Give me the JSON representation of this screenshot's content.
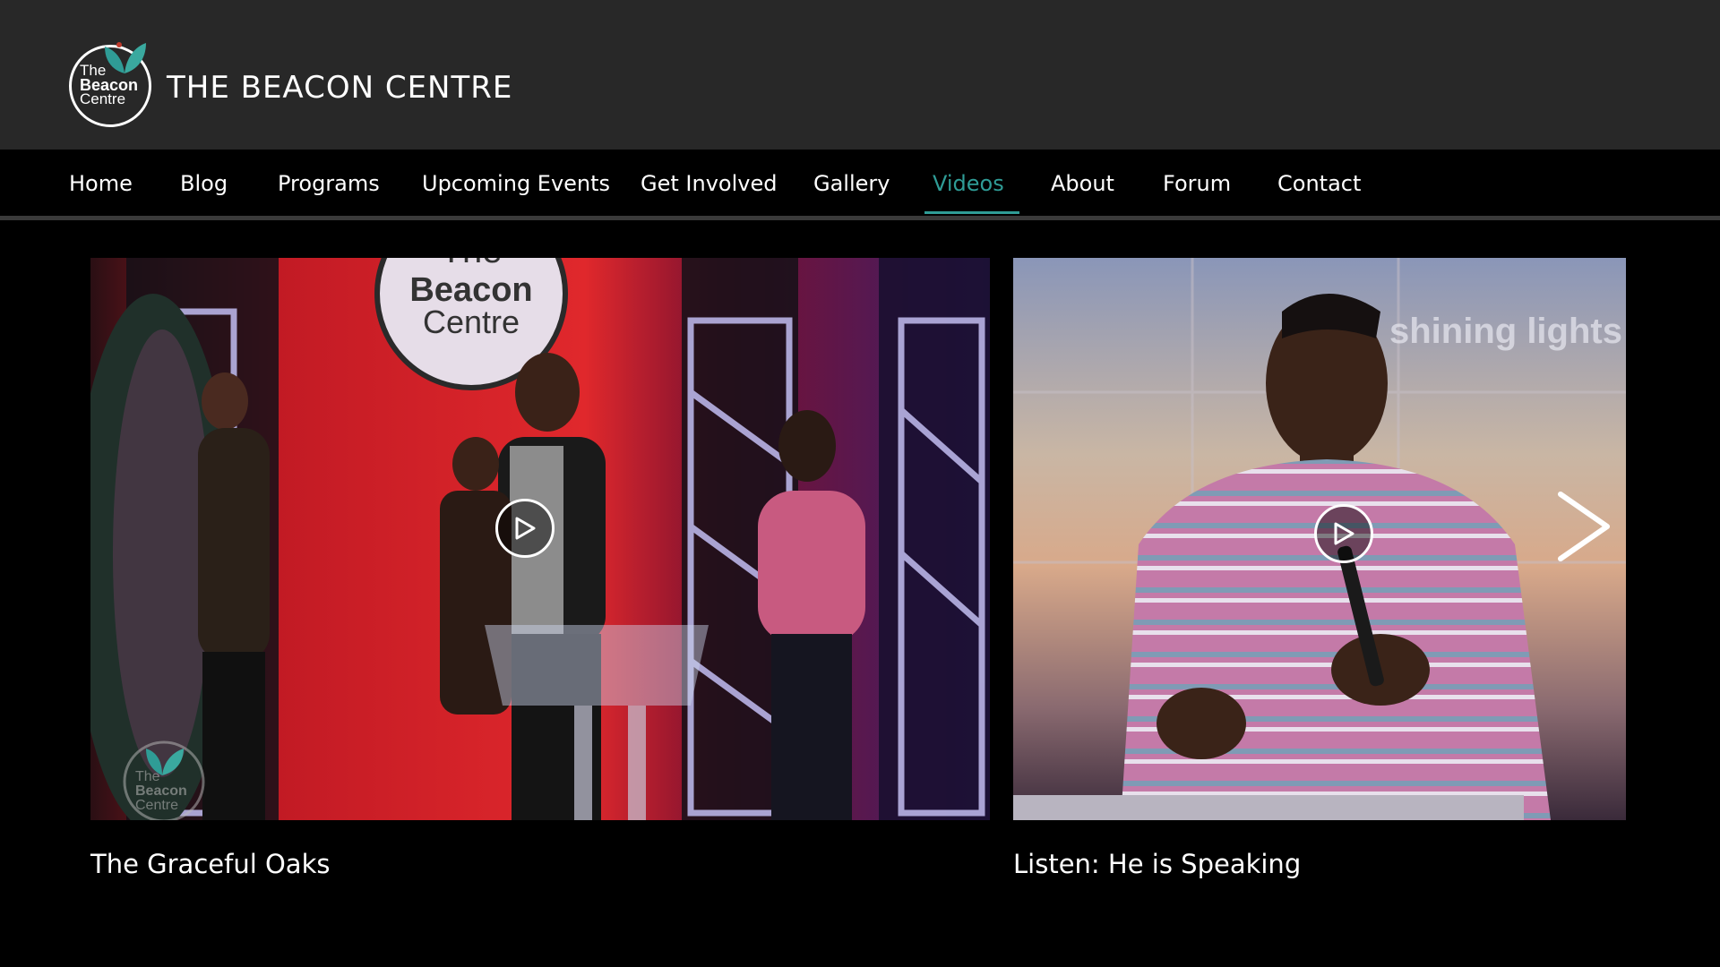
{
  "header": {
    "logo_line1": "The",
    "logo_line2": "Beacon",
    "logo_line3": "Centre",
    "site_title": "THE BEACON CENTRE"
  },
  "nav": {
    "items": [
      {
        "label": "Home"
      },
      {
        "label": "Blog"
      },
      {
        "label": "Programs"
      },
      {
        "label": "Upcoming Events"
      },
      {
        "label": "Get Involved"
      },
      {
        "label": "Gallery"
      },
      {
        "label": "Videos"
      },
      {
        "label": "About"
      },
      {
        "label": "Forum"
      },
      {
        "label": "Contact"
      }
    ],
    "active": "Videos",
    "active_color": "#2f9c96"
  },
  "videos": [
    {
      "title": "The Graceful Oaks",
      "thumbnail_sign_line1": "The",
      "thumbnail_sign_line2": "Beacon",
      "thumbnail_sign_line3": "Centre",
      "watermark_line1": "The",
      "watermark_line2": "Beacon",
      "watermark_line3": "Centre"
    },
    {
      "title": "Listen: He is Speaking",
      "thumbnail_screen_text": "shining lights"
    }
  ],
  "icons": {
    "play": "play-icon",
    "next": "chevron-right-icon"
  },
  "colors": {
    "header_bg": "#282828",
    "nav_bg": "#000000",
    "accent": "#2f9c96"
  }
}
